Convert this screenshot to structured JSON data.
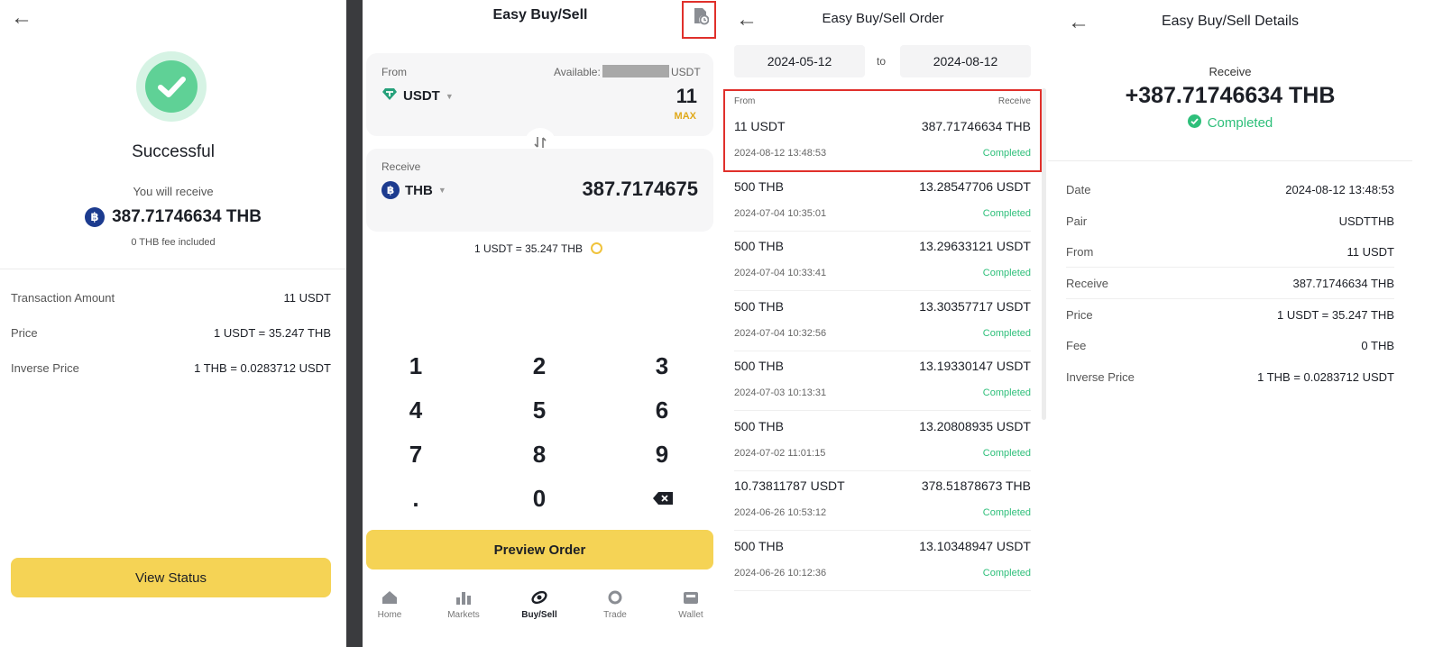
{
  "panel1": {
    "title": "Successful",
    "receive_label": "You will receive",
    "amount": "387.71746634  THB",
    "fee_note": "0 THB fee included",
    "rows": [
      {
        "label": "Transaction Amount",
        "value": "11 USDT"
      },
      {
        "label": "Price",
        "value": "1 USDT = 35.247 THB"
      },
      {
        "label": "Inverse Price",
        "value": "1 THB = 0.0283712 USDT"
      }
    ],
    "button_label": "View Status"
  },
  "panel2": {
    "title": "Easy Buy/Sell",
    "from_label": "From",
    "available_label": "Available:",
    "available_unit": "USDT",
    "from_coin": "USDT",
    "from_amount": "11",
    "max_label": "MAX",
    "receive_label": "Receive",
    "receive_coin": "THB",
    "receive_amount": "387.7174675",
    "rate": "1 USDT = 35.247 THB",
    "keys": [
      "1",
      "2",
      "3",
      "4",
      "5",
      "6",
      "7",
      "8",
      "9",
      ".",
      "0"
    ],
    "preview_label": "Preview Order",
    "nav": [
      {
        "label": "Home",
        "icon": "home-icon"
      },
      {
        "label": "Markets",
        "icon": "markets-icon"
      },
      {
        "label": "Buy/Sell",
        "icon": "buy-sell-icon",
        "active": true
      },
      {
        "label": "Trade",
        "icon": "trade-icon"
      },
      {
        "label": "Wallet",
        "icon": "wallet-icon"
      }
    ]
  },
  "panel3": {
    "title": "Easy Buy/Sell Order",
    "date_from": "2024-05-12",
    "to_label": "to",
    "date_to": "2024-08-12",
    "col_from": "From",
    "col_receive": "Receive",
    "orders": [
      {
        "from": "11 USDT",
        "receive": "387.71746634 THB",
        "time": "2024-08-12 13:48:53",
        "status": "Completed"
      },
      {
        "from": "500 THB",
        "receive": "13.28547706 USDT",
        "time": "2024-07-04 10:35:01",
        "status": "Completed"
      },
      {
        "from": "500 THB",
        "receive": "13.29633121 USDT",
        "time": "2024-07-04 10:33:41",
        "status": "Completed"
      },
      {
        "from": "500 THB",
        "receive": "13.30357717 USDT",
        "time": "2024-07-04 10:32:56",
        "status": "Completed"
      },
      {
        "from": "500 THB",
        "receive": "13.19330147 USDT",
        "time": "2024-07-03 10:13:31",
        "status": "Completed"
      },
      {
        "from": "500 THB",
        "receive": "13.20808935 USDT",
        "time": "2024-07-02 11:01:15",
        "status": "Completed"
      },
      {
        "from": "10.73811787 USDT",
        "receive": "378.51878673 THB",
        "time": "2024-06-26 10:53:12",
        "status": "Completed"
      },
      {
        "from": "500 THB",
        "receive": "13.10348947 USDT",
        "time": "2024-06-26 10:12:36",
        "status": "Completed"
      }
    ]
  },
  "panel4": {
    "title": "Easy Buy/Sell Details",
    "receive_label": "Receive",
    "receive_amount": "+387.71746634 THB",
    "status": "Completed",
    "rows": [
      {
        "label": "Date",
        "value": "2024-08-12 13:48:53"
      },
      {
        "label": "Pair",
        "value": "USDTTHB"
      },
      {
        "label": "From",
        "value": "11 USDT"
      },
      {
        "label": "Receive",
        "value": "387.71746634 THB"
      },
      {
        "label": "Price",
        "value": "1 USDT = 35.247 THB"
      },
      {
        "label": "Fee",
        "value": "0 THB"
      },
      {
        "label": "Inverse Price",
        "value": "1 THB = 0.0283712 USDT"
      }
    ]
  },
  "colors": {
    "accent_yellow": "#f5d355",
    "success_green": "#2ebf7a",
    "highlight_red": "#e0302b",
    "baht_blue": "#1c3b8f",
    "tether_green": "#26a17b"
  }
}
